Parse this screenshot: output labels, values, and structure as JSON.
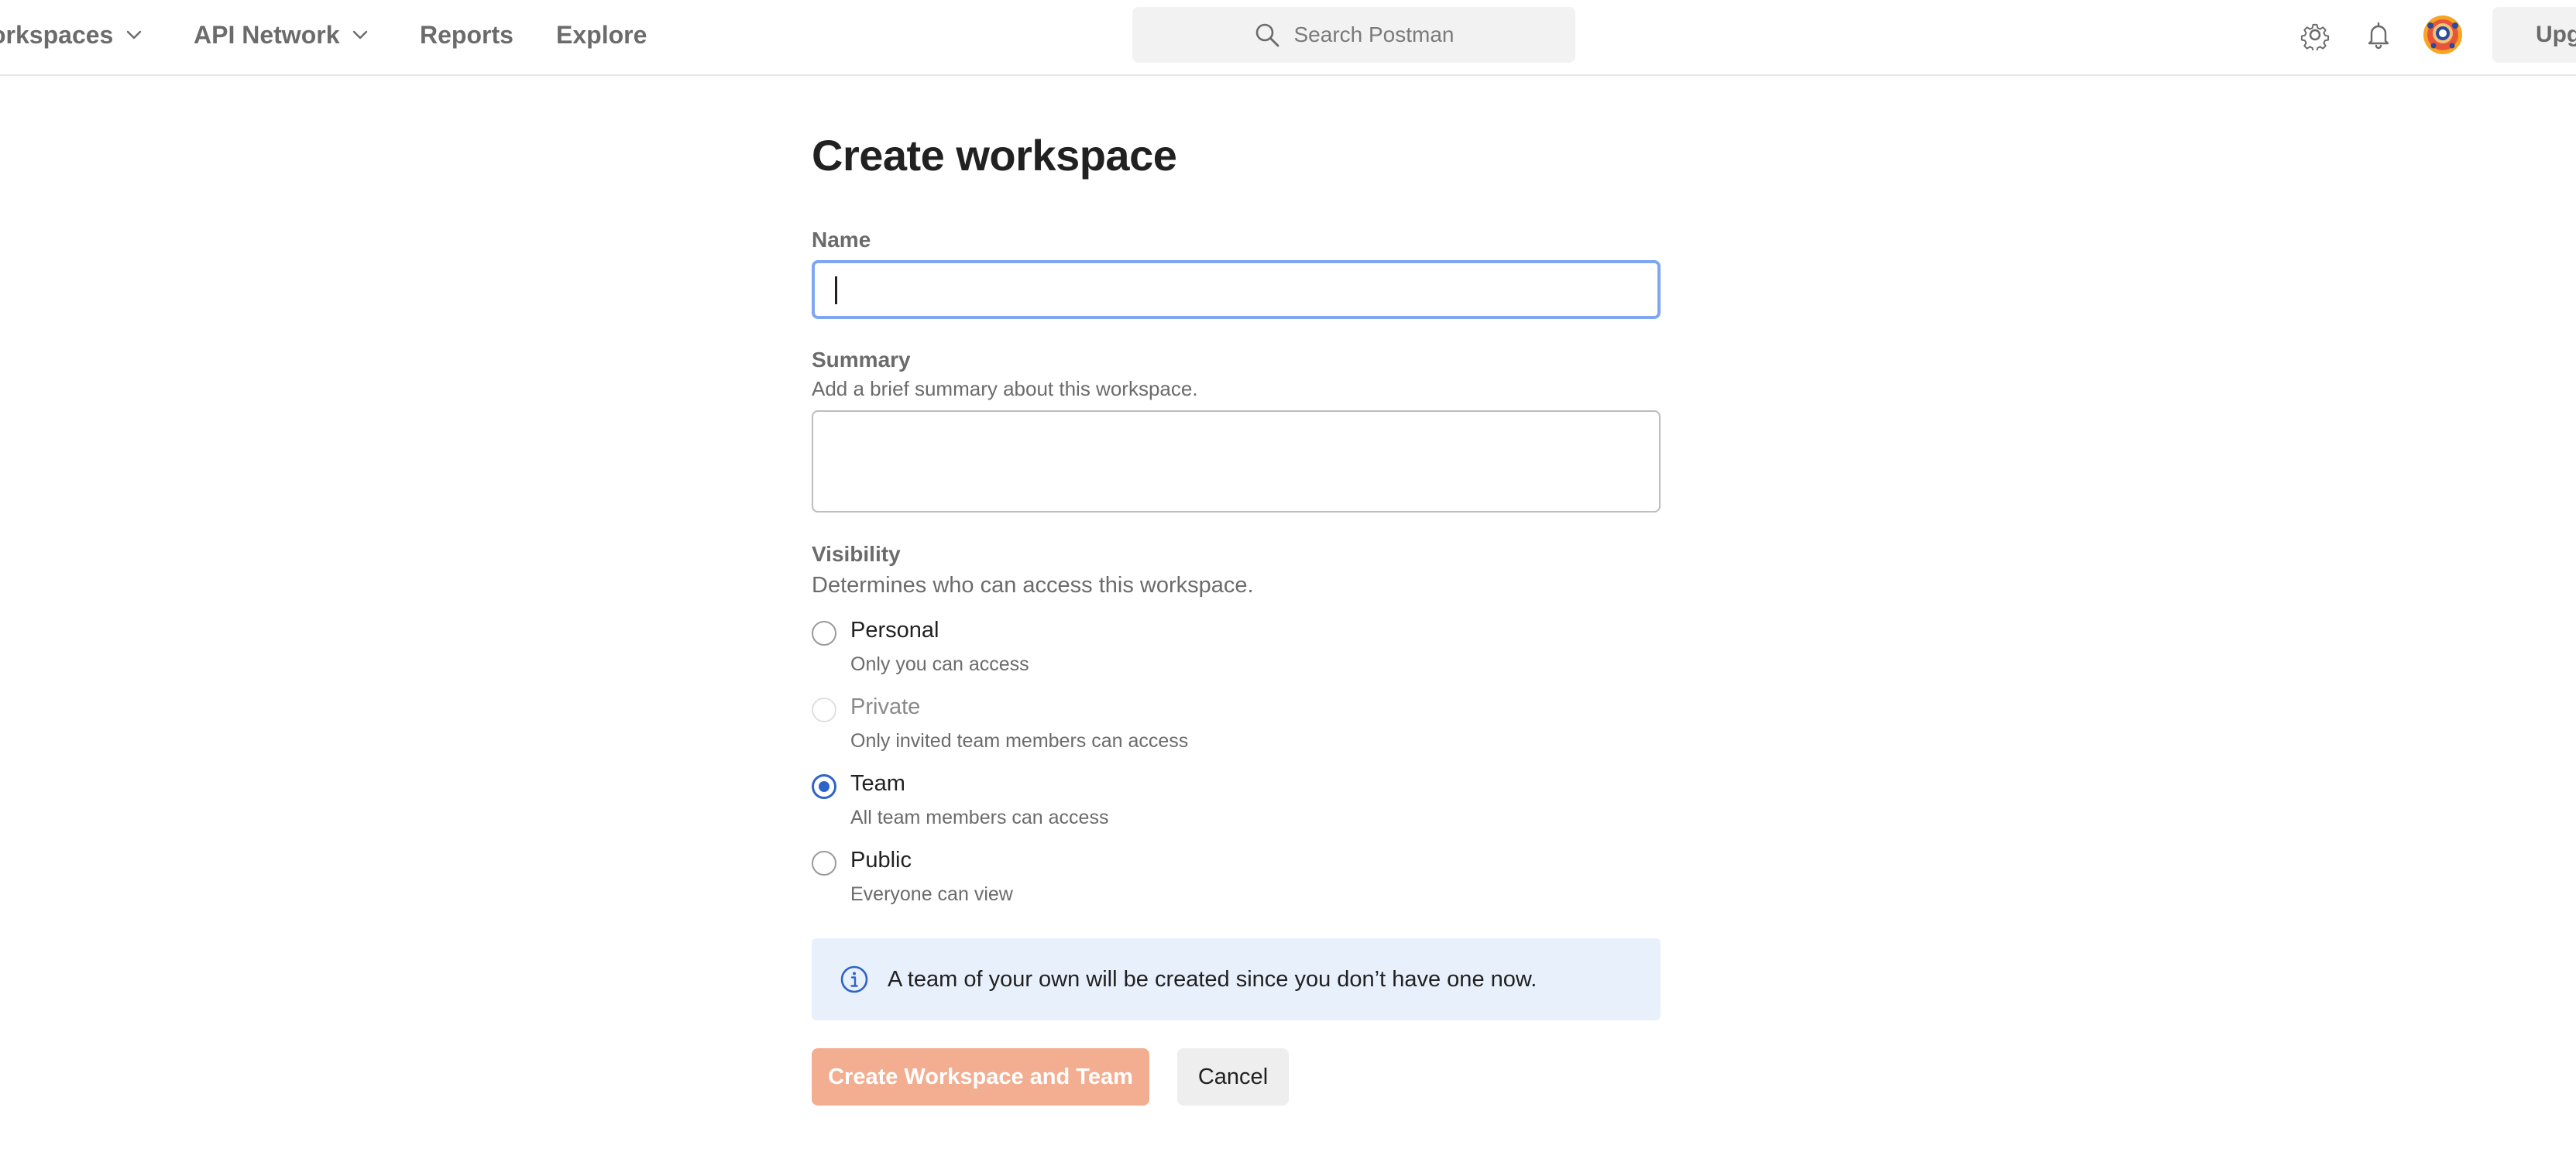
{
  "nav": {
    "items": [
      {
        "label": "orkspaces",
        "has_dropdown": true,
        "dropdown_icon": "chevron-down-icon"
      },
      {
        "label": "API Network",
        "has_dropdown": true,
        "dropdown_icon": "chevron-down-icon"
      },
      {
        "label": "Reports",
        "has_dropdown": false
      },
      {
        "label": "Explore",
        "has_dropdown": false
      }
    ]
  },
  "search": {
    "placeholder": "Search Postman",
    "icon": "search-icon"
  },
  "header_icons": {
    "settings": "gear-icon",
    "notifications": "bell-icon",
    "avatar": "avatar-icon"
  },
  "upgrade": {
    "label": "Upgr"
  },
  "form": {
    "title": "Create workspace",
    "name": {
      "label": "Name",
      "value": ""
    },
    "summary": {
      "label": "Summary",
      "help": "Add a brief summary about this workspace.",
      "value": ""
    },
    "visibility": {
      "label": "Visibility",
      "help": "Determines who can access this workspace.",
      "selected": "Team",
      "options": [
        {
          "title": "Personal",
          "description": "Only you can access",
          "checked": false,
          "disabled": false
        },
        {
          "title": "Private",
          "description": "Only invited team members can access",
          "checked": false,
          "disabled": true
        },
        {
          "title": "Team",
          "description": "All team members can access",
          "checked": true,
          "disabled": false
        },
        {
          "title": "Public",
          "description": "Everyone can view",
          "checked": false,
          "disabled": false
        }
      ]
    },
    "info": {
      "icon": "info-icon",
      "text": "A team of your own will be created since you don’t have one now."
    },
    "buttons": {
      "primary_label": "Create Workspace and Team",
      "cancel_label": "Cancel"
    }
  },
  "colors": {
    "accent_blue": "#2e63c9",
    "focus_border": "#7ea6f2",
    "primary_button_disabled": "#f3ad90",
    "info_background": "#e8f0fc"
  }
}
